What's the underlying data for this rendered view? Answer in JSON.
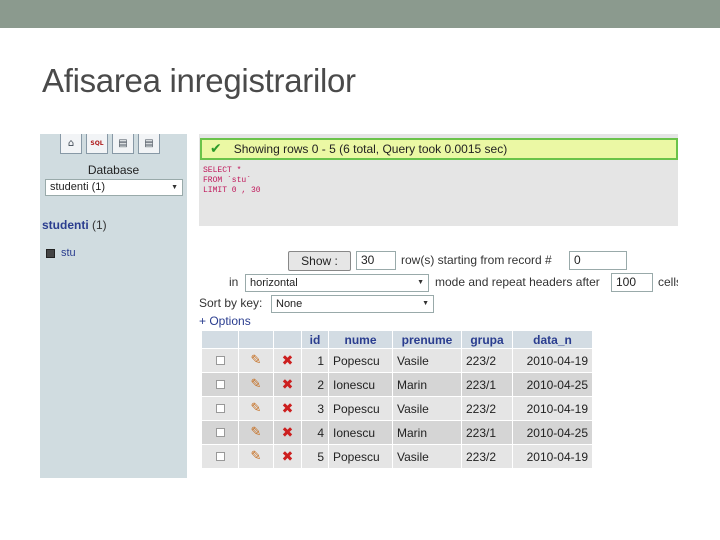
{
  "slide": {
    "title": "Afisarea inregistrarilor"
  },
  "nav": {
    "icons": [
      "home-icon",
      "sql-icon",
      "query-window-icon",
      "documentation-icon"
    ],
    "sql_icon_text": "SQL",
    "database_label": "Database",
    "database_select_value": "studenti (1)",
    "db_name": "studenti",
    "db_count": "(1)",
    "table_name": "stu"
  },
  "main": {
    "success_message": "Showing rows 0 - 5 (6 total, Query took 0.0015 sec)",
    "sql_query": "SELECT *\nFROM `stu`\nLIMIT 0 , 30",
    "show_button": "Show :",
    "rows_value": "30",
    "rows_label": "row(s) starting from record #",
    "start_value": "0",
    "in_label": "in",
    "mode_value": "horizontal",
    "mode_label": "mode and repeat headers after",
    "headers_value": "100",
    "cells_label": "cells",
    "sort_label": "Sort by key:",
    "sort_value": "None",
    "options_link": "+ Options"
  },
  "table": {
    "columns": [
      "id",
      "nume",
      "prenume",
      "grupa",
      "data_n"
    ],
    "rows": [
      {
        "id": "1",
        "nume": "Popescu",
        "prenume": "Vasile",
        "grupa": "223/2",
        "data_n": "2010-04-19"
      },
      {
        "id": "2",
        "nume": "Ionescu",
        "prenume": "Marin",
        "grupa": "223/1",
        "data_n": "2010-04-25"
      },
      {
        "id": "3",
        "nume": "Popescu",
        "prenume": "Vasile",
        "grupa": "223/2",
        "data_n": "2010-04-19"
      },
      {
        "id": "4",
        "nume": "Ionescu",
        "prenume": "Marin",
        "grupa": "223/1",
        "data_n": "2010-04-25"
      },
      {
        "id": "5",
        "nume": "Popescu",
        "prenume": "Vasile",
        "grupa": "223/2",
        "data_n": "2010-04-19"
      }
    ]
  },
  "colors": {
    "accent_bar": "#8b9a8e",
    "link": "#2a3d8f",
    "success_bg": "#ebf8a4",
    "success_border": "#6ac34a"
  }
}
